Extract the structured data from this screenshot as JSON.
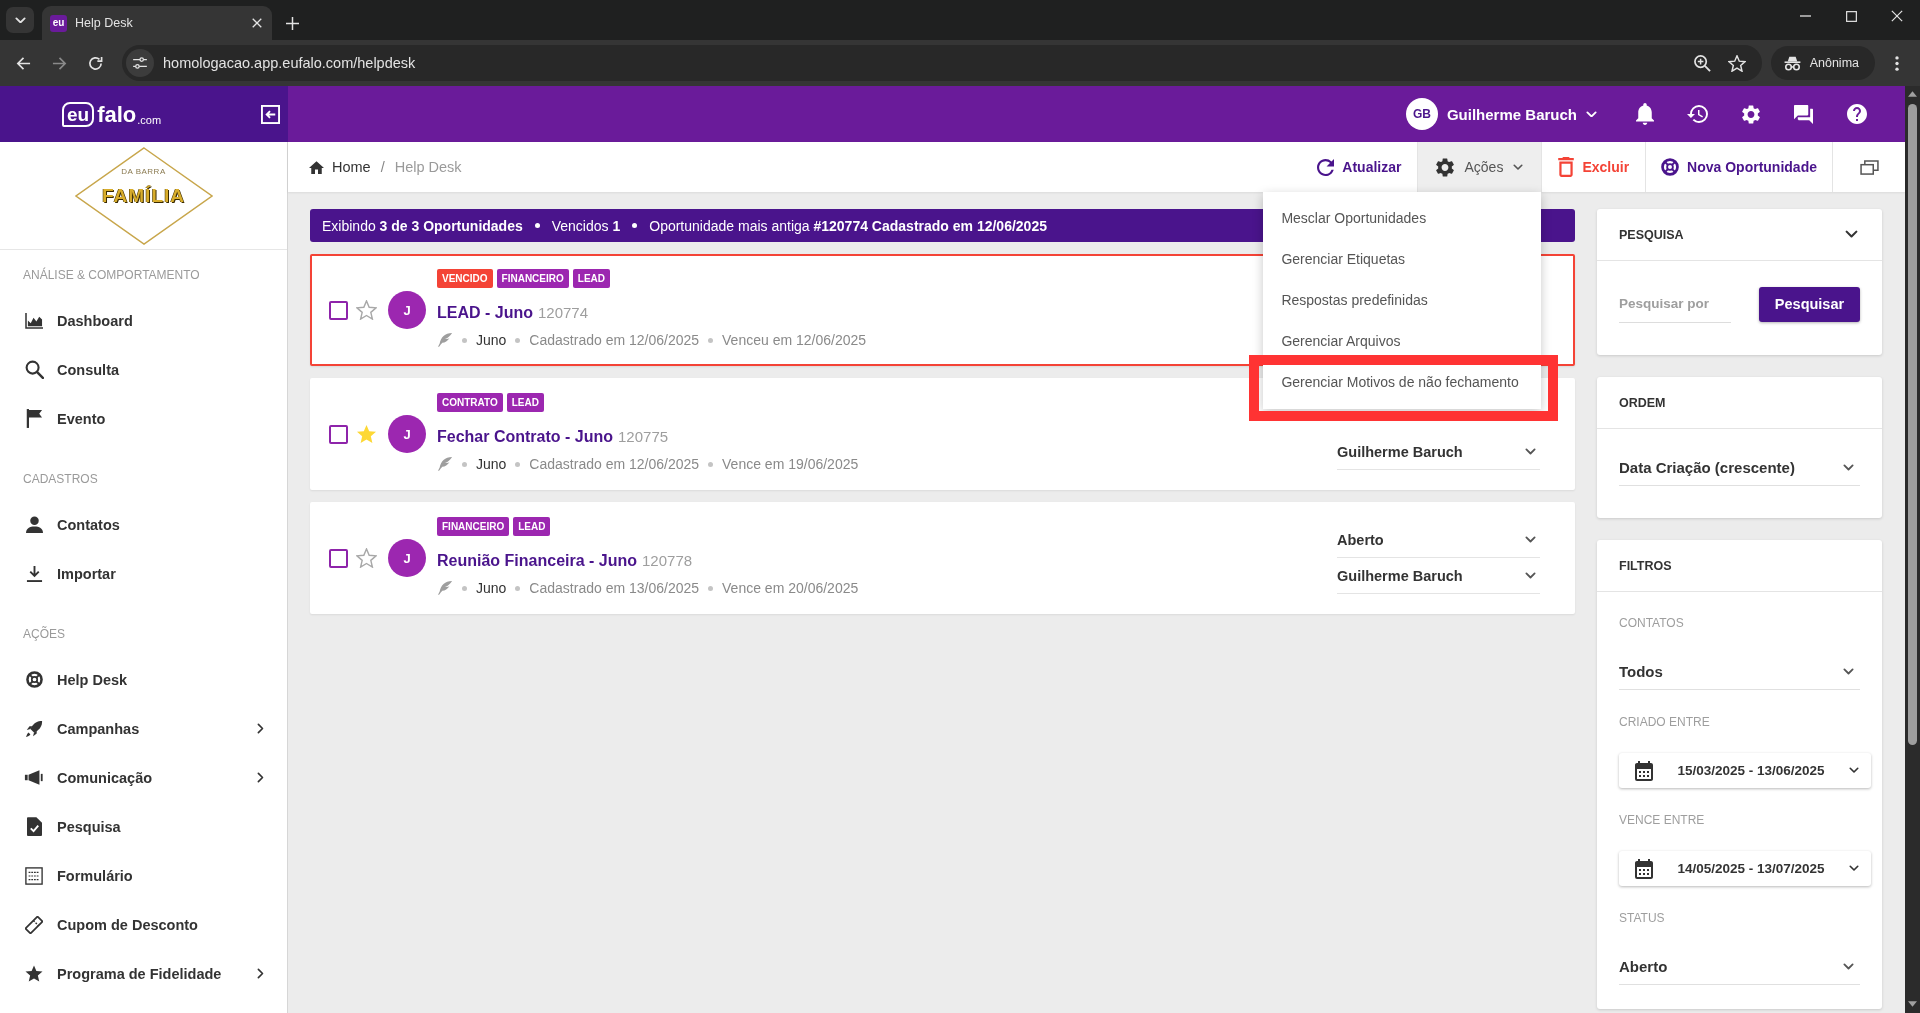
{
  "browser": {
    "favicon": "eu",
    "tab_title": "Help Desk",
    "url": "homologacao.app.eufalo.com/helpdesk",
    "profile": "Anônima"
  },
  "header": {
    "logo": {
      "mark": "eu",
      "name": "falo",
      "suffix": ".com"
    },
    "user": {
      "initials": "GB",
      "name": "Guilherme Baruch"
    }
  },
  "sidebar": {
    "brand": {
      "tagline": "DA BARRA",
      "name": "FAMÍLIA"
    },
    "sections": [
      {
        "title": "ANÁLISE & COMPORTAMENTO",
        "items": [
          {
            "label": "Dashboard",
            "submenu": false
          },
          {
            "label": "Consulta",
            "submenu": false
          },
          {
            "label": "Evento",
            "submenu": false
          }
        ]
      },
      {
        "title": "CADASTROS",
        "items": [
          {
            "label": "Contatos",
            "submenu": false
          },
          {
            "label": "Importar",
            "submenu": false
          }
        ]
      },
      {
        "title": "AÇÕES",
        "items": [
          {
            "label": "Help Desk",
            "submenu": false
          },
          {
            "label": "Campanhas",
            "submenu": true
          },
          {
            "label": "Comunicação",
            "submenu": true
          },
          {
            "label": "Pesquisa",
            "submenu": false
          },
          {
            "label": "Formulário",
            "submenu": false
          },
          {
            "label": "Cupom de Desconto",
            "submenu": false
          },
          {
            "label": "Programa de Fidelidade",
            "submenu": true
          }
        ]
      }
    ]
  },
  "breadcrumb": {
    "items": [
      "Home",
      "Help Desk"
    ],
    "separator": "/"
  },
  "toolbar": [
    {
      "kind": "refresh",
      "label": "Atualizar"
    },
    {
      "kind": "menu",
      "label": "Ações",
      "expanded": true
    },
    {
      "kind": "delete",
      "label": "Excluir"
    },
    {
      "kind": "create",
      "label": "Nova Oportunidade"
    },
    {
      "kind": "window"
    }
  ],
  "actions_menu": [
    {
      "label": "Mesclar Oportunidades",
      "highlighted": false
    },
    {
      "label": "Gerenciar Etiquetas",
      "highlighted": false
    },
    {
      "label": "Respostas predefinidas",
      "highlighted": false
    },
    {
      "label": "Gerenciar Arquivos",
      "highlighted": false
    },
    {
      "label": "Gerenciar Motivos de não fechamento",
      "highlighted": true
    }
  ],
  "summary": [
    "Exibindo **3 de 3 Oportunidades**",
    "Vencidos **1**",
    "Oportunidade mais antiga **#120774 Cadastrado em 12/06/2025**"
  ],
  "opportunities": [
    {
      "checked": false,
      "starred": false,
      "overdue": true,
      "avatar": "J",
      "tags": [
        {
          "label": "VENCIDO",
          "color": "#f44336"
        },
        {
          "label": "FINANCEIRO",
          "color": "#9c27b0"
        },
        {
          "label": "LEAD",
          "color": "#9c27b0"
        }
      ],
      "title": "LEAD - Juno",
      "id": "120774",
      "contact": "Juno",
      "created": "Cadastrado em 12/06/2025",
      "due": "Venceu em 12/06/2025"
    },
    {
      "checked": false,
      "starred": true,
      "overdue": false,
      "avatar": "J",
      "tags": [
        {
          "label": "CONTRATO",
          "color": "#9c27b0"
        },
        {
          "label": "LEAD",
          "color": "#9c27b0"
        }
      ],
      "title": "Fechar Contrato - Juno",
      "id": "120775",
      "contact": "Juno",
      "created": "Cadastrado em 12/06/2025",
      "due": "Vence em 19/06/2025",
      "assignee": "Guilherme Baruch"
    },
    {
      "checked": false,
      "starred": false,
      "overdue": false,
      "avatar": "J",
      "tags": [
        {
          "label": "FINANCEIRO",
          "color": "#9c27b0"
        },
        {
          "label": "LEAD",
          "color": "#9c27b0"
        }
      ],
      "title": "Reunião Financeira - Juno",
      "id": "120778",
      "contact": "Juno",
      "created": "Cadastrado em 13/06/2025",
      "due": "Vence em 20/06/2025",
      "status": "Aberto",
      "assignee": "Guilherme Baruch"
    }
  ],
  "search_panel": {
    "title": "PESQUISA",
    "placeholder": "Pesquisar por",
    "button": "Pesquisar"
  },
  "order_panel": {
    "title": "ORDEM",
    "value": "Data Criação (crescente)"
  },
  "filters_panel": {
    "title": "FILTROS",
    "fields": [
      {
        "kind": "select",
        "label": "CONTATOS",
        "value": "Todos"
      },
      {
        "kind": "daterange",
        "label": "CRIADO ENTRE",
        "value": "15/03/2025 - 13/06/2025"
      },
      {
        "kind": "daterange",
        "label": "VENCE ENTRE",
        "value": "14/05/2025 - 13/07/2025"
      },
      {
        "kind": "select",
        "label": "STATUS",
        "value": "Aberto"
      }
    ]
  }
}
